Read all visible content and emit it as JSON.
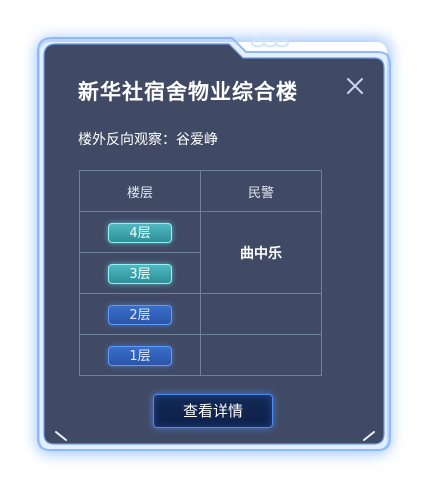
{
  "dialog": {
    "title": "新华社宿舍物业综合楼",
    "observer_label": "楼外反向观察：谷爱峥"
  },
  "table": {
    "headers": {
      "floor": "楼层",
      "police": "民警"
    },
    "rows": [
      {
        "floor": "4层",
        "state": "active",
        "police": "曲中乐"
      },
      {
        "floor": "3层",
        "state": "active",
        "police": "曲中乐"
      },
      {
        "floor": "2层",
        "state": "inactive",
        "police": ""
      },
      {
        "floor": "1层",
        "state": "inactive",
        "police": ""
      }
    ]
  },
  "actions": {
    "detail_label": "查看详情"
  },
  "icons": {
    "close": "close-icon",
    "deco_chain": "link-chain-icon"
  },
  "colors": {
    "panel_fill": "#404a64",
    "panel_border": "#7fb2ff",
    "accent_glow": "#4e8ff7",
    "active_floor": "#3fa7b0",
    "inactive_floor": "#2f5fb8",
    "table_line": "#6f819b"
  }
}
